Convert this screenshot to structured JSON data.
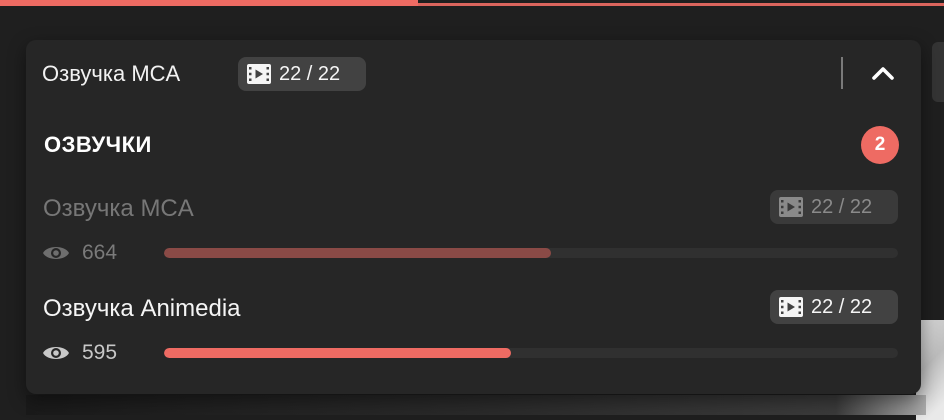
{
  "colors": {
    "accent": "#ee6b63",
    "panel_bg": "#262626",
    "badge_bg": "#424242",
    "inactive_text": "#777777"
  },
  "header": {
    "selected_dub": "Озвучка MCA",
    "episodes": "22 / 22",
    "episodes_icon": "film-icon",
    "collapse_icon": "chevron-up-icon"
  },
  "section": {
    "title": "ОЗВУЧКИ",
    "count": "2"
  },
  "dubs": [
    {
      "name": "Озвучка MCA",
      "episodes": "22 / 22",
      "views": "664",
      "views_icon": "eye-icon",
      "popularity": 0.527,
      "state": "inactive"
    },
    {
      "name": "Озвучка Animedia",
      "episodes": "22 / 22",
      "views": "595",
      "views_icon": "eye-icon",
      "popularity": 0.473,
      "state": "active"
    }
  ]
}
